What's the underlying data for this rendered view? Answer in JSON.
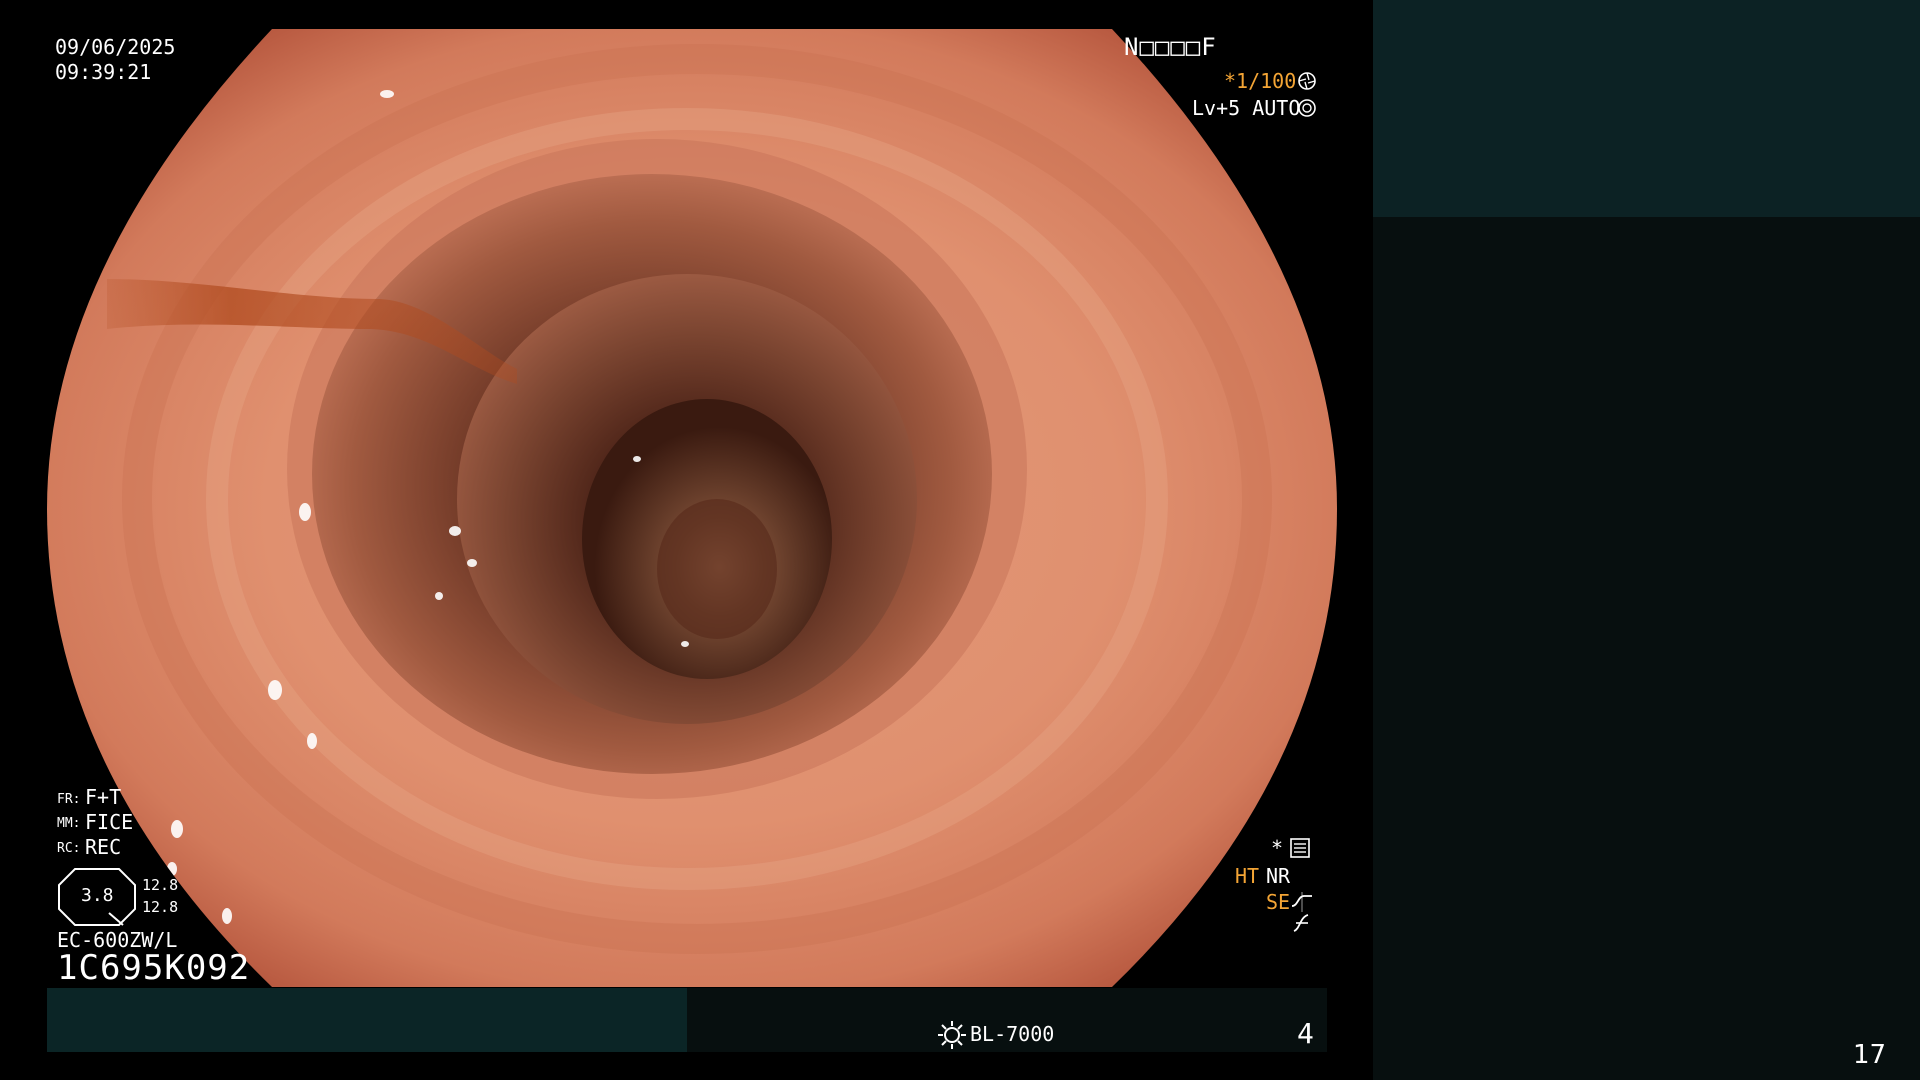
{
  "overlay": {
    "date": "09/06/2025",
    "time": "09:39:21",
    "patient_id": "N□□□□F",
    "shutter": "*1/100",
    "iris": "Lv+5 AUTO",
    "fr_label": "FR:",
    "fr_value": "F+T",
    "mm_label": "MM:",
    "mm_value": "FICE",
    "rc_label": "RC:",
    "rc_value": "REC",
    "zoom_value": "3.8",
    "zoom_a": "12.8",
    "zoom_b": "12.8",
    "scope_model": "EC-600ZW/L",
    "scope_serial": "1C695K092",
    "star": "*",
    "ht": "HT",
    "nr": "NR",
    "se": "SE",
    "light_source": "BL-7000",
    "frame_number": "4"
  },
  "page": {
    "number": "17"
  },
  "icons": [
    "aperture-icon",
    "iris-icon",
    "menu-icon",
    "se-curve-icon",
    "f-curve-icon",
    "lamp-icon"
  ],
  "colors": {
    "accent_orange": "#f4a535",
    "panel_dark_teal": "#0c2224",
    "panel_dark": "#070f0f",
    "mucosa": "#d47c5e"
  }
}
